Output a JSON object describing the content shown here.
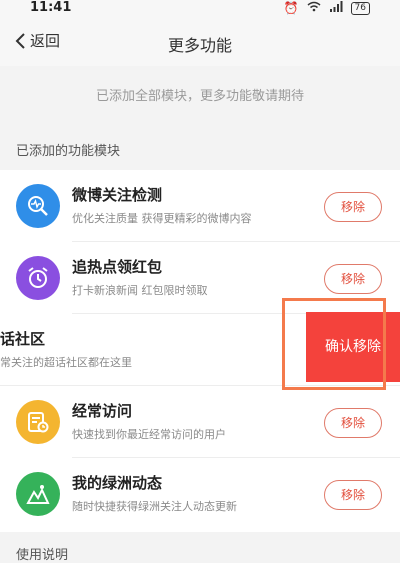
{
  "status_bar": {
    "time": "11:41",
    "icons": [
      "alarm-icon",
      "wifi-icon",
      "signal-icon"
    ],
    "battery": "76"
  },
  "nav": {
    "back_label": "返回",
    "title": "更多功能"
  },
  "notice": "已添加全部模块，更多功能敬请期待",
  "section_label": "已添加的功能模块",
  "modules": [
    {
      "title": "微博关注检测",
      "desc": "优化关注质量 获得更精彩的微博内容",
      "action": "移除",
      "icon": "search-pulse-icon",
      "color": "#2f8ee8"
    },
    {
      "title": "追热点领红包",
      "desc": "打卡新浪新闻 红包限时领取",
      "action": "移除",
      "icon": "alarm-clock-icon",
      "color": "#8a4fe0"
    },
    {
      "title": "话社区",
      "desc": "常关注的超话社区都在这里",
      "action": "确认移除",
      "icon": "",
      "color": "#f4423c"
    },
    {
      "title": "经常访问",
      "desc": "快速找到你最近经常访问的用户",
      "action": "移除",
      "icon": "visit-card-icon",
      "color": "#f4b530"
    },
    {
      "title": "我的绿洲动态",
      "desc": "随时快捷获得绿洲关注人动态更新",
      "action": "移除",
      "icon": "oasis-icon",
      "color": "#35b25a"
    }
  ],
  "footer_label": "使用说明"
}
